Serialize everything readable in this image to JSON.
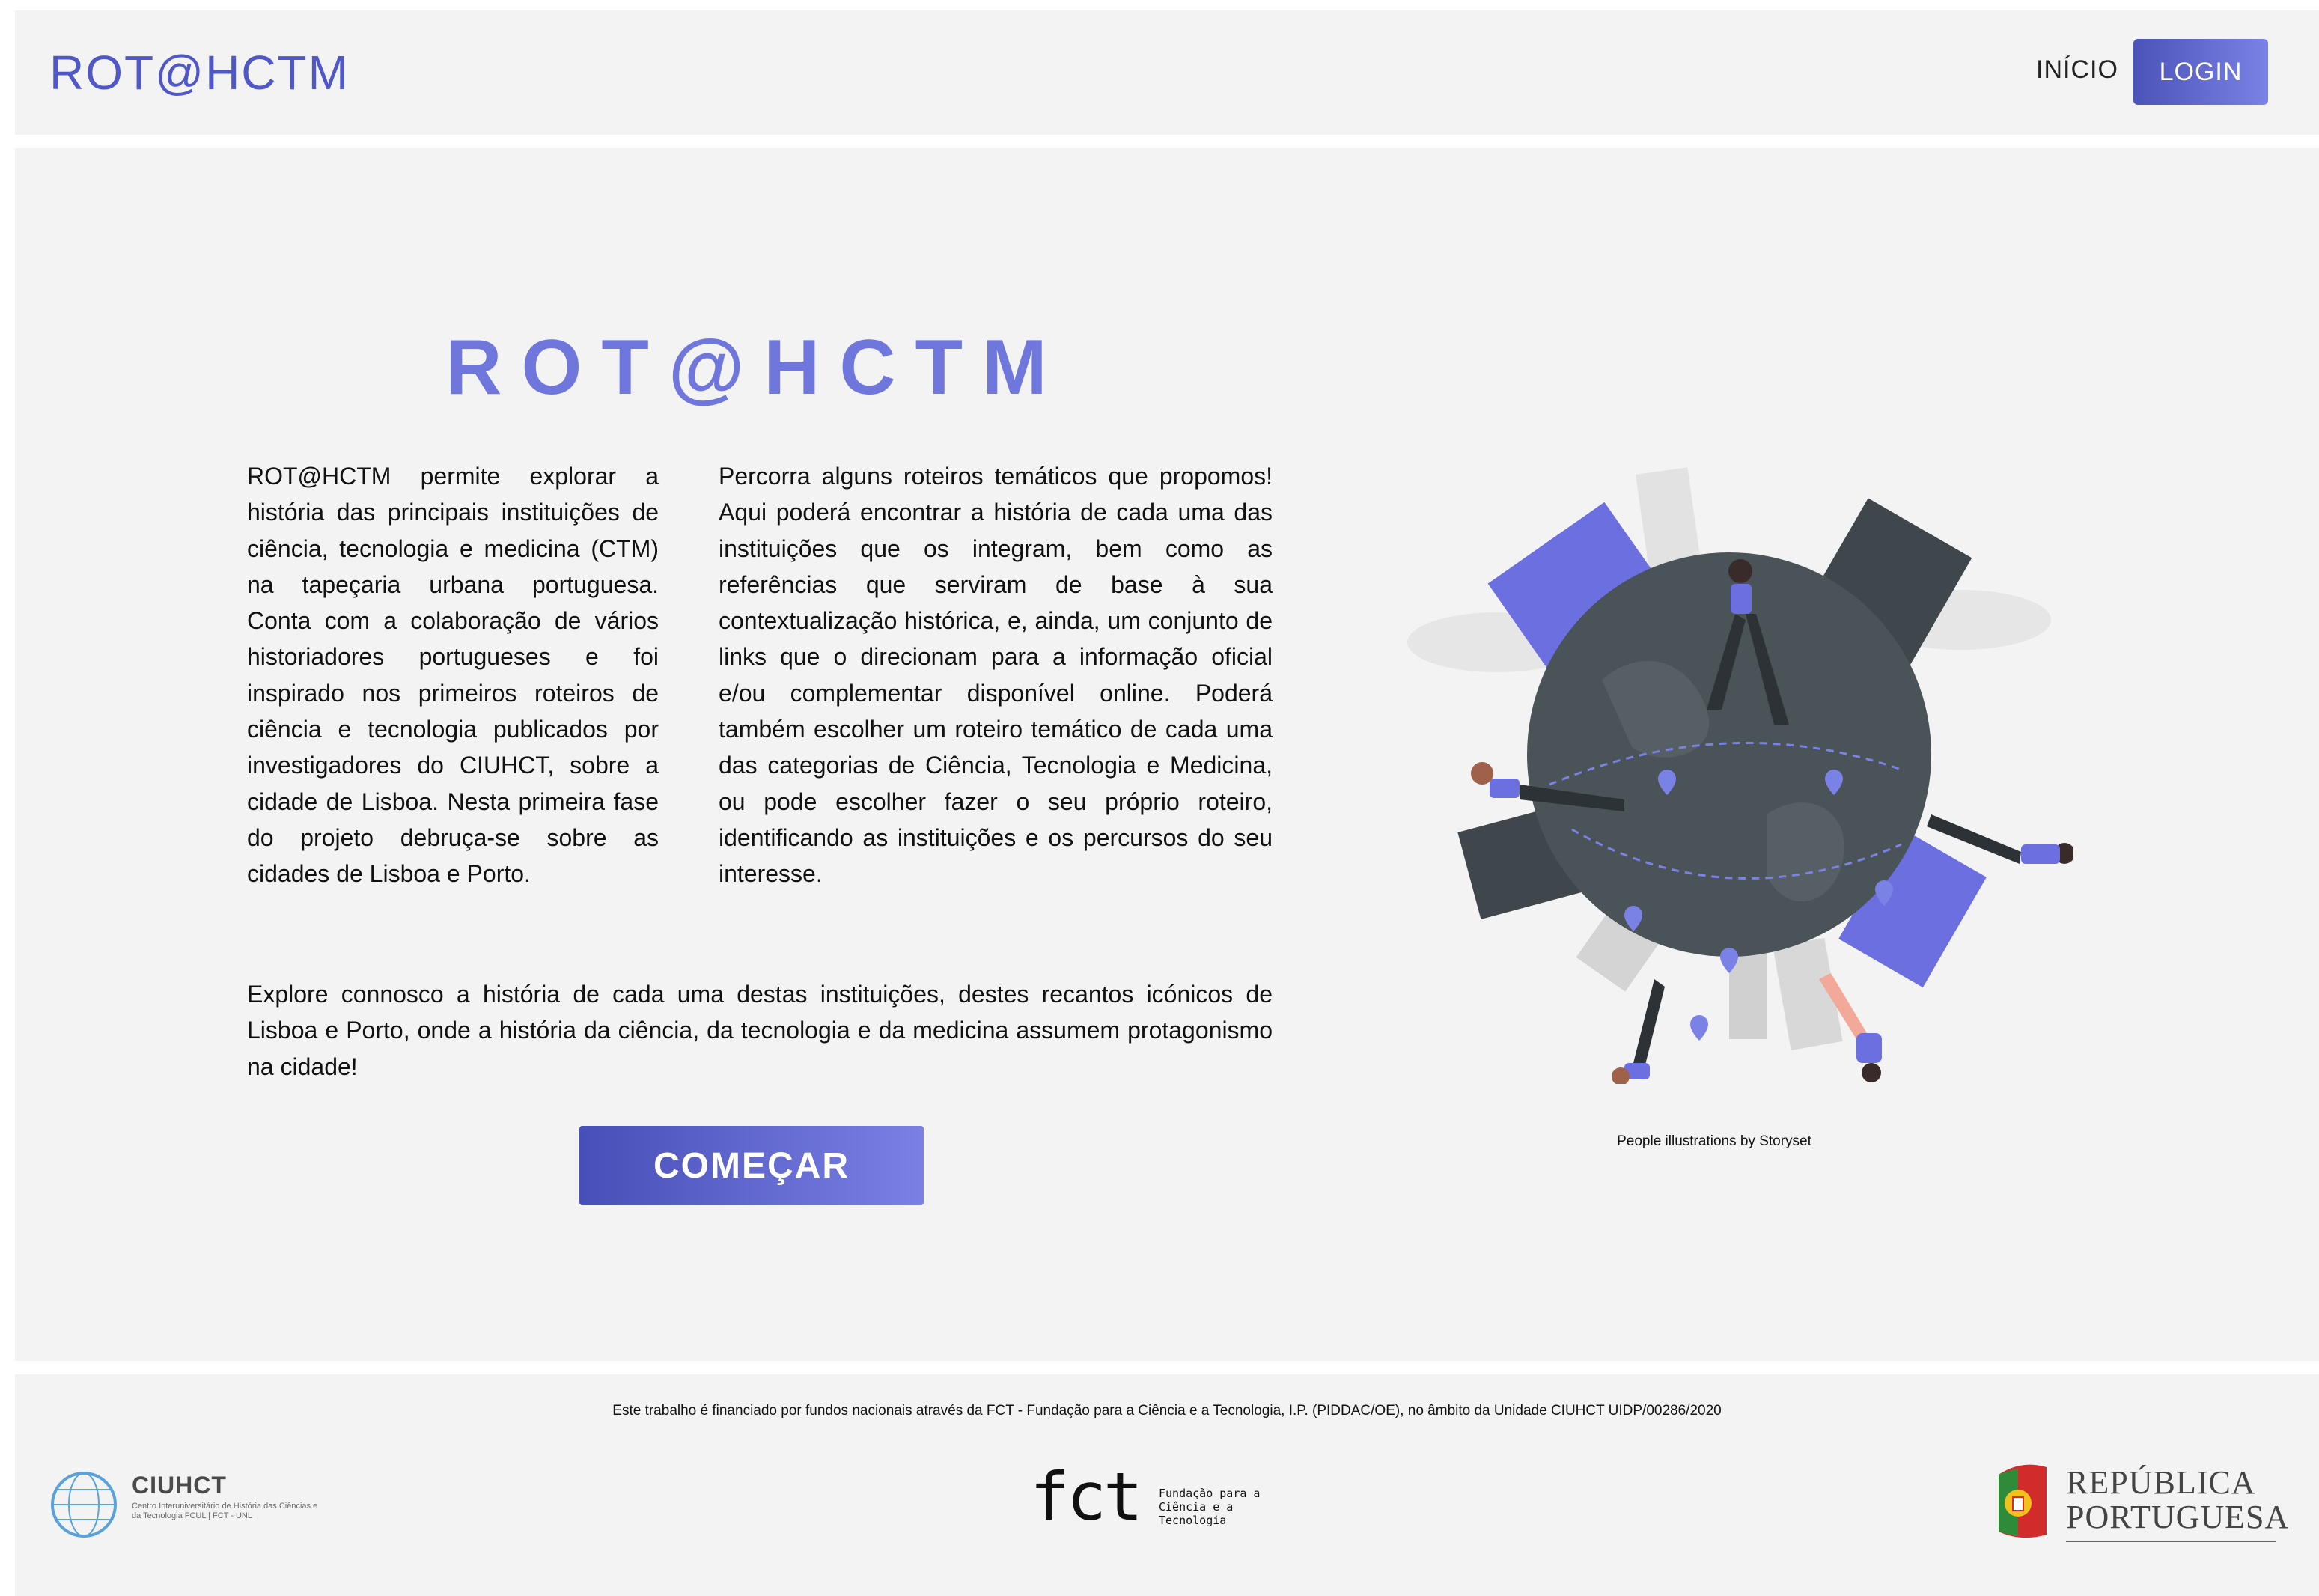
{
  "header": {
    "brand": "ROT@HCTM",
    "nav_inicio": "INÍCIO",
    "login_label": "LOGIN"
  },
  "hero": {
    "title": "ROT@HCTM",
    "paragraph1": "ROT@HCTM permite explorar a história das principais instituições de ciência, tecnologia e medicina (CTM) na tapeçaria urbana portuguesa. Conta com a colaboração de vários historiadores portugueses e foi inspirado nos primeiros roteiros de ciência e tecnologia publicados por investigadores do CIUHCT, sobre a cidade de Lisboa. Nesta primeira fase do projeto debruça-se sobre as cidades de Lisboa e Porto.",
    "paragraph2": "Percorra alguns roteiros temáticos que propomos! Aqui poderá encontrar a história de cada uma das instituições que os integram, bem como as referências que serviram de base à sua contextualização histórica, e, ainda, um conjunto de links que o direcionam para a informação oficial e/ou complementar disponível online. Poderá também escolher um roteiro temático de cada uma das categorias de Ciência, Tecnologia e Medicina, ou pode escolher fazer o seu próprio roteiro, identificando as instituições e os percursos do seu interesse.",
    "paragraph3": "Explore connosco a história de cada uma destas instituições, destes recantos icónicos de Lisboa e Porto, onde a história da ciência, da tecnologia e da medicina assumem protagonismo na cidade!",
    "start_label": "COMEÇAR",
    "illustration_credit": "People illustrations by Storyset"
  },
  "footer": {
    "funding_text": "Este trabalho é financiado por fundos nacionais através da FCT - Fundação para a Ciência e a Tecnologia, I.P. (PIDDAC/OE), no âmbito da Unidade CIUHCT UIDP/00286/2020",
    "ciuhct_name": "CIUHCT",
    "ciuhct_sub": "Centro Interuniversitário de História das Ciências e da Tecnologia FCUL | FCT - UNL",
    "fct_mark": "fct",
    "fct_sub": "Fundação para a Ciência e a Tecnologia",
    "rp_text": "REPÚBLICA PORTUGUESA"
  },
  "colors": {
    "brand": "#4f58c6",
    "accent_gradient_start": "#4a53b8",
    "accent_gradient_end": "#7b82e6",
    "panel_bg": "#f3f3f3",
    "globe": "#4a5358"
  },
  "icons": [
    "globe-illustration",
    "map-pin-icon",
    "ciuhct-logo",
    "fct-logo",
    "republica-portuguesa-logo"
  ]
}
